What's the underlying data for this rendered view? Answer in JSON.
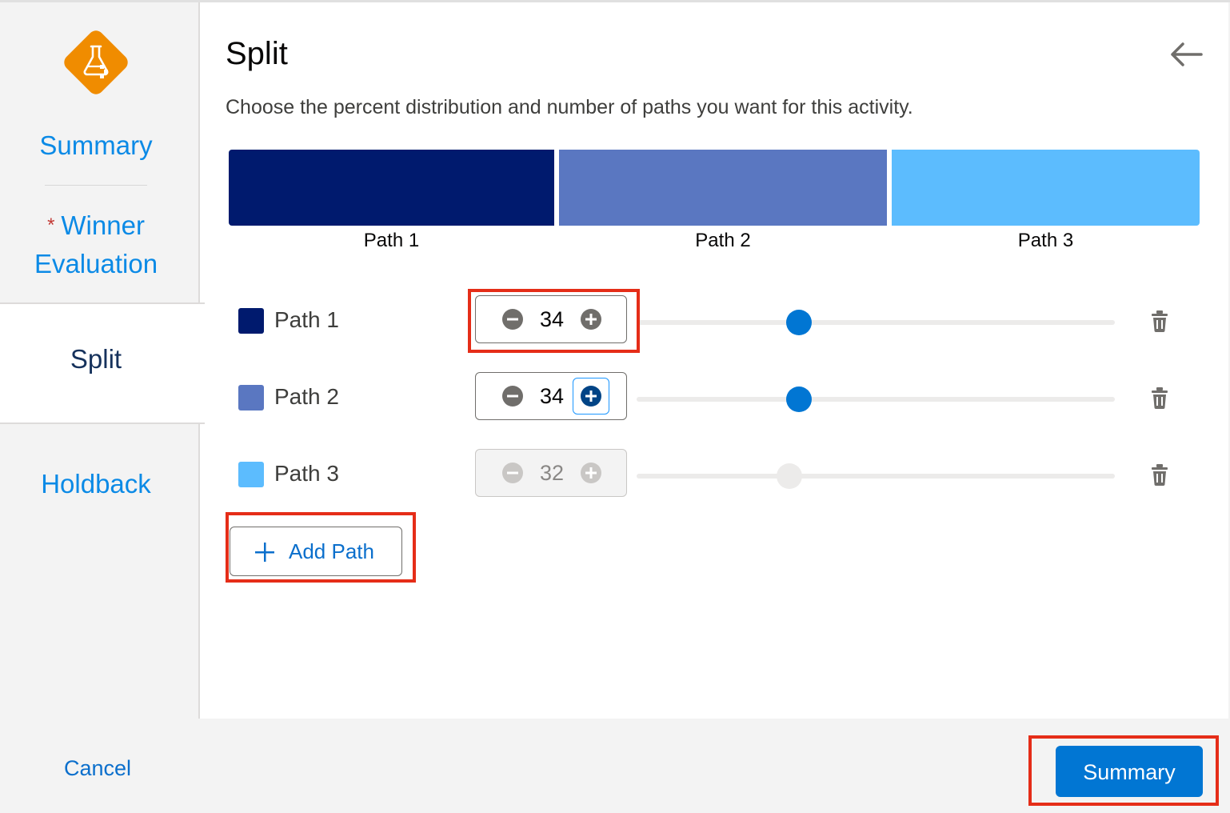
{
  "sidebar": {
    "items": [
      {
        "label": "Summary"
      },
      {
        "required_mark": "*",
        "label_line1": "Winner",
        "label_line2": "Evaluation"
      },
      {
        "label": "Split",
        "active": true
      },
      {
        "label": "Holdback"
      }
    ]
  },
  "main": {
    "title": "Split",
    "subtitle": "Choose the percent distribution and number of paths you want for this activity."
  },
  "distribution_bar": [
    {
      "label": "Path 1",
      "percent": 34,
      "color": "#001a6e"
    },
    {
      "label": "Path 2",
      "percent": 34,
      "color": "#5a77c1"
    },
    {
      "label": "Path 3",
      "percent": 32,
      "color": "#5cbcfe"
    }
  ],
  "paths": [
    {
      "name": "Path 1",
      "value": "34",
      "color": "#001a6e",
      "slider_fraction": 0.34,
      "disabled": false
    },
    {
      "name": "Path 2",
      "value": "34",
      "color": "#5a77c1",
      "slider_fraction": 0.34,
      "disabled": false
    },
    {
      "name": "Path 3",
      "value": "32",
      "color": "#5cbcfe",
      "slider_fraction": 0.32,
      "disabled": true
    }
  ],
  "add_path_label": "Add Path",
  "footer": {
    "cancel_label": "Cancel",
    "summary_label": "Summary"
  },
  "colors": {
    "accent": "#0176d3",
    "link": "#0b8ae6",
    "highlight": "#e52d18",
    "logo": "#f08c00"
  }
}
